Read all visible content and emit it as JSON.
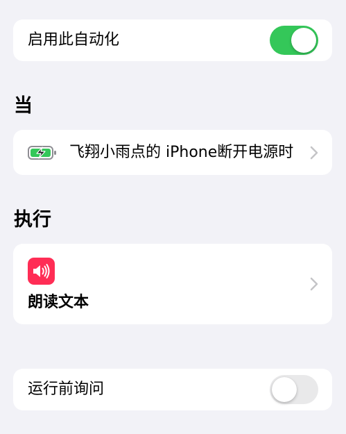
{
  "automation": {
    "enable_label": "启用此自动化",
    "enabled": true
  },
  "trigger": {
    "section_title": "当",
    "description": "飞翔小雨点的 iPhone断开电源时",
    "icon": "battery-charging-icon"
  },
  "action": {
    "section_title": "执行",
    "label": "朗读文本",
    "icon": "speaker-wave-icon",
    "icon_color": "#ff2d55"
  },
  "ask_before_running": {
    "label": "运行前询问",
    "enabled": false
  },
  "colors": {
    "toggle_on": "#34c759",
    "toggle_off": "#e9e9ea",
    "background": "#f2f2f7",
    "chevron": "#c4c4c7"
  }
}
